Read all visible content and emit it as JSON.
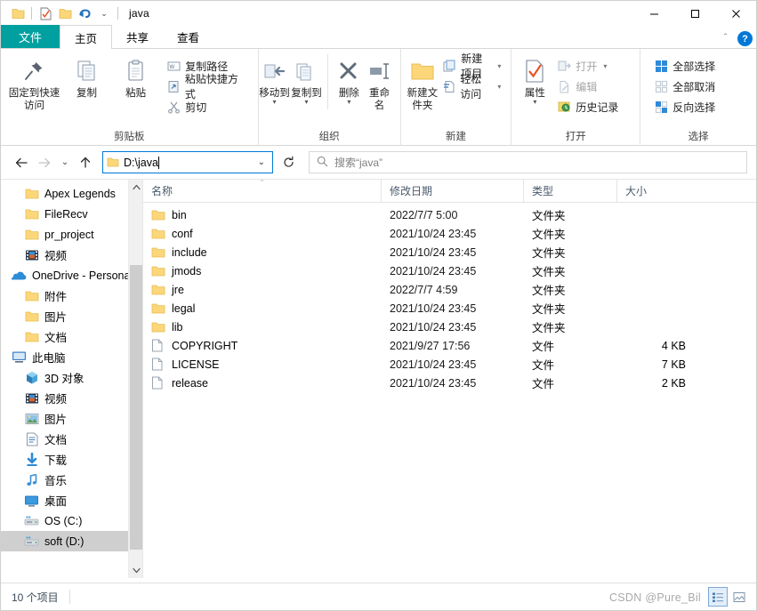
{
  "window": {
    "title": "java",
    "minimize_label": "—",
    "maximize_label": "☐",
    "close_label": "✕"
  },
  "quick_access": {
    "items": [
      {
        "name": "folder-icon",
        "label": ""
      },
      {
        "name": "properties-icon",
        "label": ""
      },
      {
        "name": "new-folder-icon",
        "label": ""
      },
      {
        "name": "undo-icon",
        "label": ""
      },
      {
        "name": "customize-caret-icon",
        "label": "⌄"
      }
    ]
  },
  "tabs": [
    {
      "id": "file",
      "label": "文件"
    },
    {
      "id": "home",
      "label": "主页"
    },
    {
      "id": "share",
      "label": "共享"
    },
    {
      "id": "view",
      "label": "查看"
    }
  ],
  "tab_right": {
    "collapse_label": "＾",
    "help_label": "?"
  },
  "ribbon": {
    "groups": [
      {
        "id": "clipboard",
        "title": "剪贴板",
        "big": [
          {
            "label": "固定到快速访问",
            "icon": "pin-icon"
          },
          {
            "label": "复制",
            "icon": "copy-icon"
          },
          {
            "label": "粘贴",
            "icon": "paste-icon"
          }
        ],
        "small": [
          {
            "label": "复制路径",
            "icon": "copy-path-icon"
          },
          {
            "label": "粘贴快捷方式",
            "icon": "paste-shortcut-icon"
          },
          {
            "label": "剪切",
            "icon": "cut-icon"
          }
        ]
      },
      {
        "id": "organize",
        "title": "组织",
        "big": [
          {
            "label": "移动到",
            "icon": "move-to-icon",
            "caret": true
          },
          {
            "label": "复制到",
            "icon": "copy-to-icon",
            "caret": true
          },
          {
            "label": "删除",
            "icon": "delete-icon",
            "caret": true
          },
          {
            "label": "重命名",
            "icon": "rename-icon"
          }
        ],
        "small": []
      },
      {
        "id": "new",
        "title": "新建",
        "big": [
          {
            "label": "新建文件夹",
            "icon": "new-folder-icon"
          }
        ],
        "small": [
          {
            "label": "新建项目",
            "icon": "new-item-icon",
            "caret": true
          },
          {
            "label": "轻松访问",
            "icon": "easy-access-icon",
            "caret": true
          }
        ]
      },
      {
        "id": "open",
        "title": "打开",
        "big": [
          {
            "label": "属性",
            "icon": "properties-icon",
            "caret": true
          }
        ],
        "small": [
          {
            "label": "打开",
            "icon": "open-icon",
            "caret": true,
            "dim": true
          },
          {
            "label": "编辑",
            "icon": "edit-icon",
            "dim": true
          },
          {
            "label": "历史记录",
            "icon": "history-icon"
          }
        ]
      },
      {
        "id": "select",
        "title": "选择",
        "big": [],
        "small": [
          {
            "label": "全部选择",
            "icon": "select-all-icon"
          },
          {
            "label": "全部取消",
            "icon": "select-none-icon"
          },
          {
            "label": "反向选择",
            "icon": "invert-selection-icon"
          }
        ]
      }
    ]
  },
  "address_bar": {
    "back_label": "←",
    "forward_label": "→",
    "recent_label": "⌄",
    "up_label": "↑",
    "path_value": "D:\\java",
    "dropdown_label": "⌄",
    "refresh_label": "↻"
  },
  "search": {
    "icon": "search-icon",
    "placeholder": "搜索“java”"
  },
  "nav_pane": {
    "items": [
      {
        "label": "Apex Legends",
        "icon": "folder-icon",
        "level": 1,
        "selected": false
      },
      {
        "label": "FileRecv",
        "icon": "folder-icon",
        "level": 1,
        "selected": false
      },
      {
        "label": "pr_project",
        "icon": "folder-icon",
        "level": 1,
        "selected": false
      },
      {
        "label": "视频",
        "icon": "video-icon",
        "level": 1,
        "selected": false
      },
      {
        "label": "OneDrive - Persona",
        "icon": "onedrive-icon",
        "level": 0,
        "selected": false
      },
      {
        "label": "附件",
        "icon": "folder-icon",
        "level": 1,
        "selected": false
      },
      {
        "label": "图片",
        "icon": "folder-icon",
        "level": 1,
        "selected": false
      },
      {
        "label": "文档",
        "icon": "folder-icon",
        "level": 1,
        "selected": false
      },
      {
        "label": "此电脑",
        "icon": "this-pc-icon",
        "level": 0,
        "selected": false
      },
      {
        "label": "3D 对象",
        "icon": "3d-objects-icon",
        "level": 1,
        "selected": false
      },
      {
        "label": "视频",
        "icon": "video-icon",
        "level": 1,
        "selected": false
      },
      {
        "label": "图片",
        "icon": "pictures-icon",
        "level": 1,
        "selected": false
      },
      {
        "label": "文档",
        "icon": "documents-icon",
        "level": 1,
        "selected": false
      },
      {
        "label": "下载",
        "icon": "downloads-icon",
        "level": 1,
        "selected": false
      },
      {
        "label": "音乐",
        "icon": "music-icon",
        "level": 1,
        "selected": false
      },
      {
        "label": "桌面",
        "icon": "desktop-icon",
        "level": 1,
        "selected": false
      },
      {
        "label": "OS (C:)",
        "icon": "drive-icon",
        "level": 1,
        "selected": false
      },
      {
        "label": "soft (D:)",
        "icon": "drive-icon",
        "level": 1,
        "selected": true
      }
    ],
    "scroll_up_label": "＾",
    "scroll_down_label": "］"
  },
  "file_list": {
    "columns": [
      {
        "key": "name",
        "label": "名称",
        "sorted": true,
        "sort_mark": "＾"
      },
      {
        "key": "date",
        "label": "修改日期",
        "sorted": false,
        "sort_mark": ""
      },
      {
        "key": "type",
        "label": "类型",
        "sorted": false,
        "sort_mark": ""
      },
      {
        "key": "size",
        "label": "大小",
        "sorted": false,
        "sort_mark": ""
      }
    ],
    "rows": [
      {
        "name": "bin",
        "date": "2022/7/7 5:00",
        "type": "文件夹",
        "size": "",
        "icon": "folder-icon"
      },
      {
        "name": "conf",
        "date": "2021/10/24 23:45",
        "type": "文件夹",
        "size": "",
        "icon": "folder-icon"
      },
      {
        "name": "include",
        "date": "2021/10/24 23:45",
        "type": "文件夹",
        "size": "",
        "icon": "folder-icon"
      },
      {
        "name": "jmods",
        "date": "2021/10/24 23:45",
        "type": "文件夹",
        "size": "",
        "icon": "folder-icon"
      },
      {
        "name": "jre",
        "date": "2022/7/7 4:59",
        "type": "文件夹",
        "size": "",
        "icon": "folder-icon"
      },
      {
        "name": "legal",
        "date": "2021/10/24 23:45",
        "type": "文件夹",
        "size": "",
        "icon": "folder-icon"
      },
      {
        "name": "lib",
        "date": "2021/10/24 23:45",
        "type": "文件夹",
        "size": "",
        "icon": "folder-icon"
      },
      {
        "name": "COPYRIGHT",
        "date": "2021/9/27 17:56",
        "type": "文件",
        "size": "4 KB",
        "icon": "file-icon"
      },
      {
        "name": "LICENSE",
        "date": "2021/10/24 23:45",
        "type": "文件",
        "size": "7 KB",
        "icon": "file-icon"
      },
      {
        "name": "release",
        "date": "2021/10/24 23:45",
        "type": "文件",
        "size": "2 KB",
        "icon": "file-icon"
      }
    ]
  },
  "status_bar": {
    "item_count": "10 个项目",
    "watermark": "CSDN @Pure_Bil",
    "view_details_icon": "details-view-icon",
    "view_large_icon": "large-icons-view-icon"
  },
  "colors": {
    "file_tab": "#00a0a0",
    "accent": "#0078d7",
    "folder": "#fcd77a",
    "selection": "#cfcfcf",
    "hover": "#e5f3ff"
  }
}
